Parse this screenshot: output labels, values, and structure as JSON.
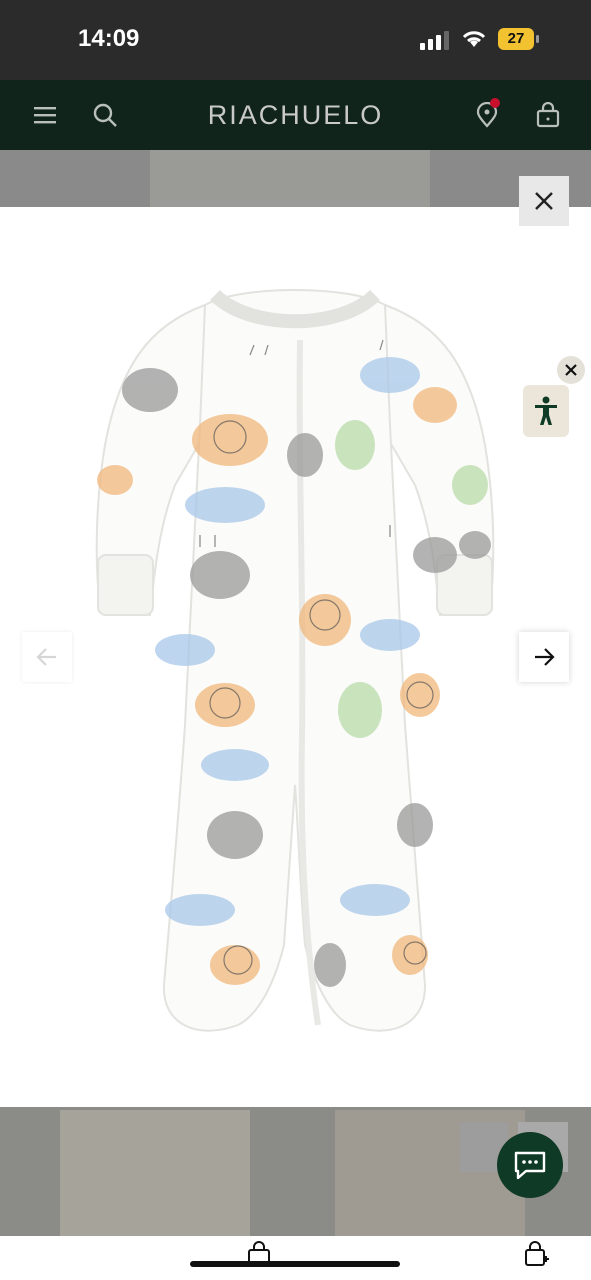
{
  "status_bar": {
    "time": "14:09",
    "battery": "27"
  },
  "header": {
    "logo": "RIACHUELO"
  },
  "icons": {
    "menu": "hamburger-menu-icon",
    "search": "search-icon",
    "location": "location-pin-icon",
    "bag": "shopping-bag-icon",
    "close": "close-icon",
    "accessibility": "accessibility-icon",
    "prev": "arrow-left-icon",
    "next": "arrow-right-icon",
    "zoom": "zoom-in-icon",
    "chat": "chat-icon"
  },
  "product_image": {
    "alt": "carter's footed sleep and play with animal print"
  },
  "colors": {
    "header_bg": "#10241c",
    "chat_bg": "#0f3a26",
    "notification_dot": "#c8102e"
  }
}
